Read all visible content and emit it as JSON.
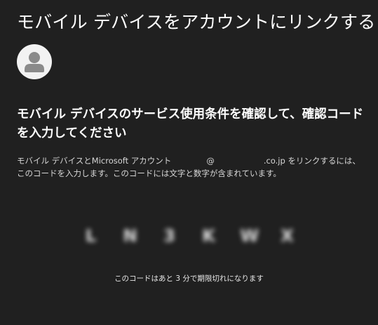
{
  "window": {
    "title": "モバイル デバイスをアカウントにリンクする"
  },
  "account": {
    "avatar_icon": "person-icon"
  },
  "main": {
    "heading": "モバイル デバイスのサービス使用条件を確認して、確認コードを入力してください",
    "description_part1": "モバイル デバイスとMicrosoft アカウント",
    "email_at": "@",
    "email_domain_suffix": ".co.jp",
    "description_part2": "をリンクするには、このコードを入力します。このコードには文字と数字が含まれています。",
    "code_chars": [
      "L",
      "N",
      "3",
      "K",
      "W",
      "X"
    ],
    "expiry_text": "このコードはあと 3 分で期限切れになります"
  },
  "colors": {
    "background": "#202020",
    "text": "#ffffff",
    "avatar_bg": "#f2f2f2",
    "avatar_fg": "#8a8a8a"
  }
}
